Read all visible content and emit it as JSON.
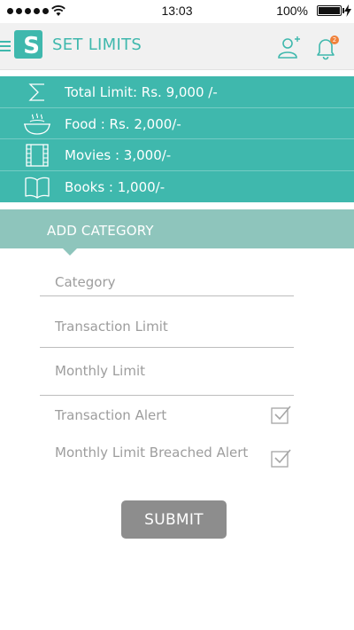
{
  "status_bar": {
    "time": "13:03",
    "battery": "100%"
  },
  "header": {
    "logo_letter": "S",
    "title": "SET LIMITS",
    "notification_count": "2",
    "icons": [
      "menu-icon",
      "add-user-icon",
      "bell-icon"
    ]
  },
  "limits": [
    {
      "icon": "sigma-icon",
      "label": "Total Limit: Rs. 9,000 /-"
    },
    {
      "icon": "food-bowl-icon",
      "label": "Food : Rs. 2,000/-"
    },
    {
      "icon": "film-icon",
      "label": "Movies : 3,000/-"
    },
    {
      "icon": "book-icon",
      "label": "Books : 1,000/-"
    }
  ],
  "add_category": {
    "label": "ADD CATEGORY"
  },
  "form": {
    "category_placeholder": "Category",
    "transaction_limit_placeholder": "Transaction Limit",
    "monthly_limit_placeholder": "Monthly Limit",
    "transaction_alert_label": "Transaction Alert",
    "transaction_alert_checked": true,
    "monthly_alert_label": "Monthly Limit Breached Alert",
    "monthly_alert_checked": true,
    "submit_label": "SUBMIT"
  },
  "colors": {
    "accent": "#3fb8ad",
    "accent_light": "#8ec5bc",
    "button": "#8d8d8d",
    "badge": "#f0813a"
  }
}
